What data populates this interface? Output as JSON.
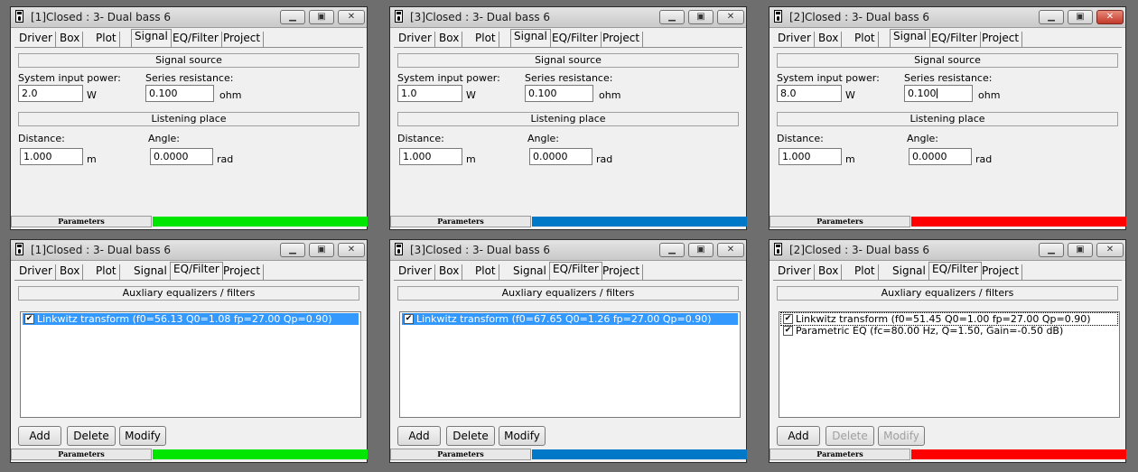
{
  "common": {
    "tabs": [
      "Driver",
      "Box",
      "Plot",
      "Signal",
      "EQ/Filter",
      "Project"
    ],
    "signal_source": "Signal source",
    "listening_place": "Listening place",
    "system_input_power_label": "System input power:",
    "series_resistance_label": "Series resistance:",
    "distance_label": "Distance:",
    "angle_label": "Angle:",
    "unit_w": "W",
    "unit_ohm": "ohm",
    "unit_m": "m",
    "unit_rad": "rad",
    "aux_header": "Auxliary equalizers / filters",
    "add": "Add",
    "delete": "Delete",
    "modify": "Modify",
    "parameters": "Parameters",
    "min_icon": "minimize-icon",
    "max_icon": "maximize-icon",
    "close_icon": "close-icon"
  },
  "windows": [
    {
      "title": "[1]Closed : 3- Dual bass 6",
      "power": "2.0",
      "resistance": "0.100",
      "distance": "1.000",
      "angle": "0.0000",
      "color": "#00e600"
    },
    {
      "title": "[3]Closed : 3- Dual bass 6",
      "power": "1.0",
      "resistance": "0.100",
      "distance": "1.000",
      "angle": "0.0000",
      "color": "#0078c8"
    },
    {
      "title": "[2]Closed : 3- Dual bass 6",
      "power": "8.0",
      "resistance": "0.100",
      "distance": "1.000",
      "angle": "0.0000",
      "color": "#ff0000"
    },
    {
      "title": "[1]Closed : 3- Dual bass 6",
      "items": [
        "Linkwitz transform (f0=56.13 Q0=1.08 fp=27.00 Qp=0.90)"
      ],
      "color": "#00e600"
    },
    {
      "title": "[3]Closed : 3- Dual bass 6",
      "items": [
        "Linkwitz transform (f0=67.65 Q0=1.26 fp=27.00 Qp=0.90)"
      ],
      "color": "#0078c8"
    },
    {
      "title": "[2]Closed : 3- Dual bass 6",
      "items": [
        "Linkwitz transform (f0=51.45 Q0=1.00 fp=27.00 Qp=0.90)",
        "Parametric EQ (fc=80.00 Hz, Q=1.50, Gain=-0.50 dB)"
      ],
      "color": "#ff0000"
    }
  ]
}
